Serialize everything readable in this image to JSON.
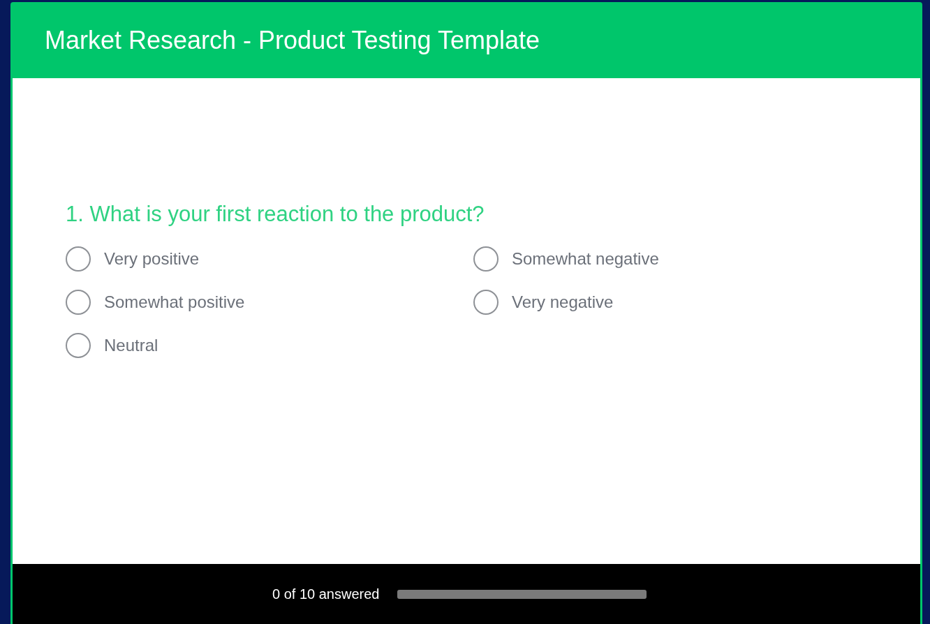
{
  "survey": {
    "title": "Market Research - Product Testing Template"
  },
  "question": {
    "text": "1. What is your first reaction to the product?",
    "options": [
      {
        "label": "Very positive",
        "selected": false
      },
      {
        "label": "Somewhat positive",
        "selected": false
      },
      {
        "label": "Neutral",
        "selected": false
      },
      {
        "label": "Somewhat negative",
        "selected": false
      },
      {
        "label": "Very negative",
        "selected": false
      }
    ]
  },
  "footer": {
    "progress_text": "0 of 10 answered",
    "progress": {
      "level": 0
    }
  }
}
